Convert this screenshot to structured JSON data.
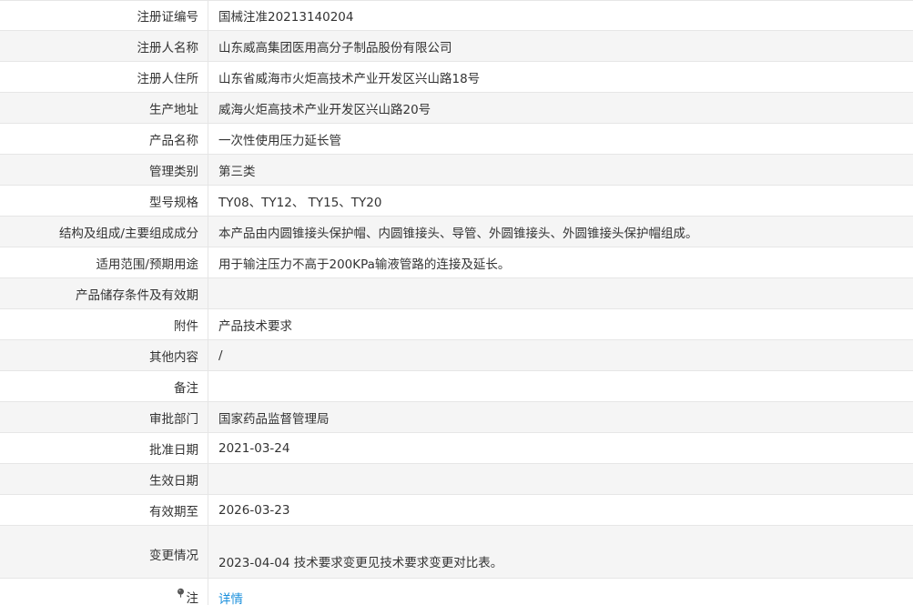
{
  "rows": [
    {
      "label": "注册证编号",
      "value": "国械注准20213140204"
    },
    {
      "label": "注册人名称",
      "value": "山东威高集团医用高分子制品股份有限公司"
    },
    {
      "label": "注册人住所",
      "value": "山东省威海市火炬高技术产业开发区兴山路18号"
    },
    {
      "label": "生产地址",
      "value": "威海火炬高技术产业开发区兴山路20号"
    },
    {
      "label": "产品名称",
      "value": "一次性使用压力延长管"
    },
    {
      "label": "管理类别",
      "value": "第三类"
    },
    {
      "label": "型号规格",
      "value": "TY08、TY12、 TY15、TY20"
    },
    {
      "label": "结构及组成/主要组成成分",
      "value": "本产品由内圆锥接头保护帽、内圆锥接头、导管、外圆锥接头、外圆锥接头保护帽组成。"
    },
    {
      "label": "适用范围/预期用途",
      "value": "用于输注压力不高于200KPa输液管路的连接及延长。"
    },
    {
      "label": "产品储存条件及有效期",
      "value": ""
    },
    {
      "label": "附件",
      "value": "产品技术要求"
    },
    {
      "label": "其他内容",
      "value": "/"
    },
    {
      "label": "备注",
      "value": ""
    },
    {
      "label": "审批部门",
      "value": "国家药品监督管理局"
    },
    {
      "label": "批准日期",
      "value": "2021-03-24"
    },
    {
      "label": "生效日期",
      "value": ""
    },
    {
      "label": "有效期至",
      "value": "2026-03-23"
    },
    {
      "label": "变更情况",
      "value": "2023-04-04 技术要求变更见技术要求变更对比表。"
    }
  ],
  "note": {
    "icon": "pin-icon",
    "label": "注",
    "link_text": "详情",
    "link_color": "#1a8fdc"
  }
}
